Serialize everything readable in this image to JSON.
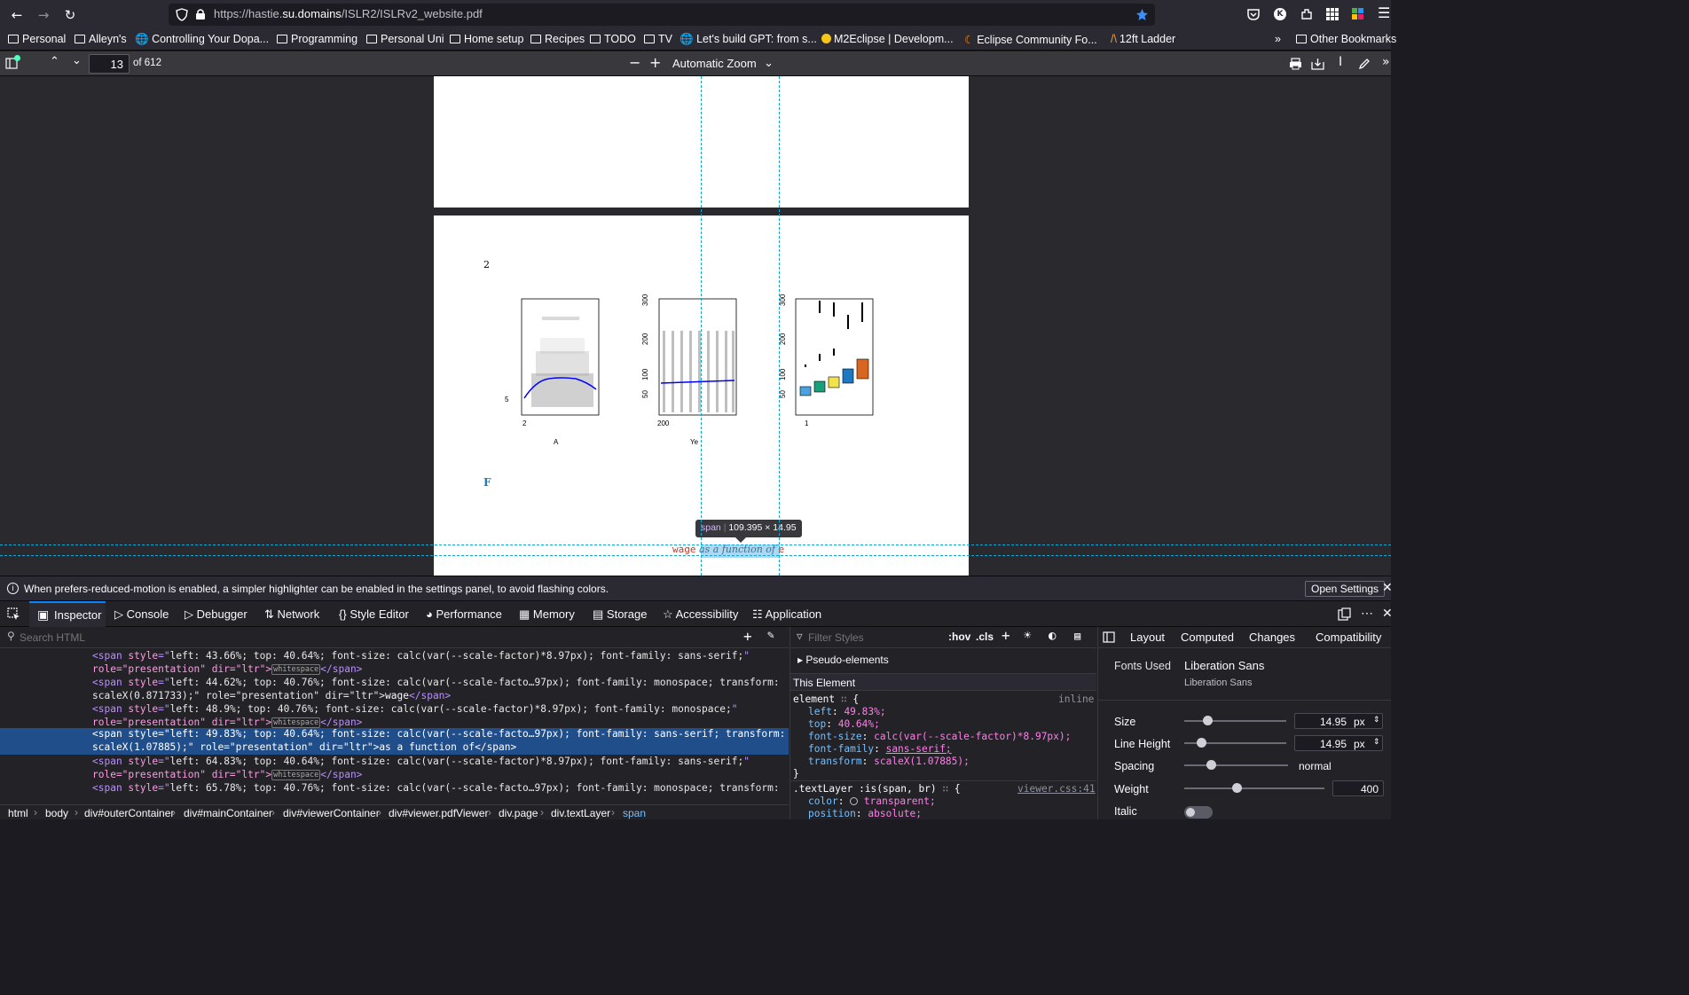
{
  "browser": {
    "url_host_prefix": "https://hastie.",
    "url_host_main": "su.domains",
    "url_path": "/ISLR2/ISLRv2_website.pdf",
    "bookmarks": [
      "Personal",
      "Alleyn's",
      "Controlling Your Dopa...",
      "Programming",
      "Personal Uni",
      "Home setup",
      "Recipes",
      "TODO",
      "TV",
      "Let's build GPT: from s...",
      "M2Eclipse | Developm...",
      "Eclipse Community Fo...",
      "12ft Ladder"
    ],
    "other_bookmarks": "Other Bookmarks",
    "profile_letter": "K"
  },
  "pdf_toolbar": {
    "page_number": "13",
    "page_count": "of 612",
    "zoom": "Automatic Zoom"
  },
  "pdf_page": {
    "page_num_label": "2",
    "figure_label": "F",
    "caption_word1": "wage",
    "caption_word2": "as a function of",
    "caption_word3": "e",
    "plot1": {
      "ytick": "5",
      "xtick": "2",
      "xlabel": "A"
    },
    "plot2": {
      "yticks": [
        "300",
        "200",
        "100",
        "50"
      ],
      "xtick": "200",
      "xlabel": "Ye"
    },
    "plot3": {
      "yticks": [
        "300",
        "200",
        "100",
        "50"
      ],
      "xtick": "1"
    },
    "tooltip_tag": "span",
    "tooltip_size": "109.395 × 14.95"
  },
  "notice": {
    "text": "When prefers-reduced-motion is enabled, a simpler highlighter can be enabled in the settings panel, to avoid flashing colors.",
    "button": "Open Settings"
  },
  "devtools": {
    "tabs": [
      "Inspector",
      "Console",
      "Debugger",
      "Network",
      "Style Editor",
      "Performance",
      "Memory",
      "Storage",
      "Accessibility",
      "Application"
    ],
    "search_placeholder": "Search HTML",
    "filter_placeholder": "Filter Styles",
    "hov": ":hov",
    "cls": ".cls",
    "layout_tabs": [
      "Layout",
      "Computed",
      "Changes",
      "Compatibility"
    ],
    "markup_rows": [
      {
        "style": "left: 43.66%; top: 40.64%; font-size: calc(var(--scale-factor)*8.97px); font-family: sans-serif;",
        "rest": "role=\"presentation\" dir=\"ltr\">",
        "ws": "whitespace",
        "end": "</span>"
      },
      {
        "style": "left: 44.62%; top: 40.76%; font-size: calc(var(--scale-facto…97px); font-family: monospace; transform:",
        "rest": "scaleX(0.871733);\" role=\"presentation\" dir=\"ltr\">",
        "text": "wage",
        "end": "</span>"
      },
      {
        "style": "left: 48.9%; top: 40.76%; font-size: calc(var(--scale-factor)*8.97px); font-family: monospace;",
        "rest": "role=\"presentation\" dir=\"ltr\">",
        "ws": "whitespace",
        "end": "</span>"
      },
      {
        "style": "left: 49.83%; top: 40.64%; font-size: calc(var(--scale-facto…97px); font-family: sans-serif; transform:",
        "rest": "scaleX(1.07885);\" role=\"presentation\" dir=\"ltr\">",
        "text": "as a function of",
        "end": "</span>"
      },
      {
        "style": "left: 64.83%; top: 40.64%; font-size: calc(var(--scale-factor)*8.97px); font-family: sans-serif;",
        "rest": "role=\"presentation\" dir=\"ltr\">",
        "ws": "whitespace",
        "end": "</span>"
      },
      {
        "style": "left: 65.78%; top: 40.76%; font-size: calc(var(--scale-facto…97px); font-family: monospace; transform:",
        "rest": "",
        "end": ""
      }
    ],
    "breadcrumbs": [
      "html",
      "body",
      "div#outerContainer",
      "div#mainContainer",
      "div#viewerContainer",
      "div#viewer.pdfViewer",
      "div.page",
      "div.textLayer",
      "span"
    ],
    "rules": {
      "pseudo": "Pseudo-elements",
      "this_element": "This Element",
      "element_selector": "element",
      "inline": "inline",
      "decls": [
        {
          "prop": "left",
          "val": "49.83%;"
        },
        {
          "prop": "top",
          "val": "40.64%;"
        },
        {
          "prop": "font-size",
          "val": "calc(var(--scale-factor)*8.97px);"
        },
        {
          "prop": "font-family",
          "val": "sans-serif;"
        },
        {
          "prop": "transform",
          "val": "scaleX(1.07885);"
        }
      ],
      "rule2_selector": ".textLayer :is(span, br)",
      "rule2_source": "viewer.css:41",
      "rule2_decls": [
        {
          "prop": "color",
          "val": "transparent;"
        },
        {
          "prop": "position",
          "val": "absolute;"
        }
      ]
    },
    "fonts": {
      "fonts_used_label": "Fonts Used",
      "font_name": "Liberation Sans",
      "font_sub": "Liberation Sans",
      "size_label": "Size",
      "size_value": "14.95",
      "size_unit": "px",
      "lh_label": "Line Height",
      "lh_value": "14.95",
      "lh_unit": "px",
      "spacing_label": "Spacing",
      "spacing_value": "normal",
      "weight_label": "Weight",
      "weight_value": "400",
      "italic_label": "Italic"
    }
  }
}
